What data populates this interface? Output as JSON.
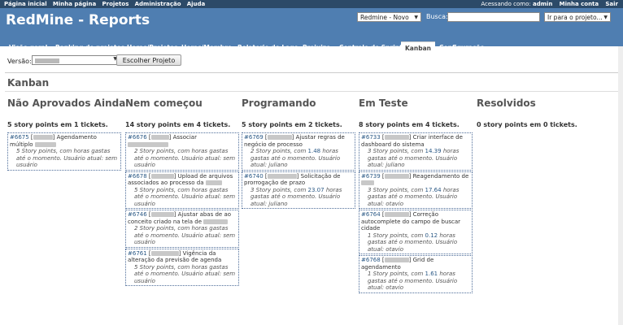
{
  "top_menu": {
    "left": [
      "Página inicial",
      "Minha página",
      "Projetos",
      "Administração",
      "Ajuda"
    ],
    "logged_as_prefix": "Acessando como:",
    "logged_as_user": "admin",
    "my_account": "Minha conta",
    "logout": "Sair"
  },
  "header": {
    "title": "RedMine - Reports",
    "project_select": "Redmine - Novo",
    "search_label": "Busca:",
    "search_value": "",
    "jump_select": "Ir para o projeto..."
  },
  "tabs": [
    {
      "label": "Visão geral"
    },
    {
      "label": "Ranking de projetos"
    },
    {
      "label": "Horas/Projetos"
    },
    {
      "label": "Horas/Membro"
    },
    {
      "label": "Relatorio do Lage"
    },
    {
      "label": "Prejuizo"
    },
    {
      "label": "Controle de Sprint"
    },
    {
      "label": "Kanban",
      "active": true
    },
    {
      "label": "Configuração"
    }
  ],
  "version": {
    "label": "Versão:",
    "button": "Escolher Projeto"
  },
  "page_title": "Kanban",
  "columns": [
    {
      "title": "Não Aprovados Ainda",
      "summary": "5 story points em 1 tickets.",
      "cards": [
        {
          "id": "#6675",
          "title": "Agendamento múltiplo",
          "meta_pre": "5 Story points, com horas gastas até o momento. Usuário atual: sem usuário",
          "hours": ""
        }
      ]
    },
    {
      "title": "Nem começou",
      "summary": "14 story points em 4 tickets.",
      "cards": [
        {
          "id": "#6676",
          "title": "Associar",
          "meta_pre": "2 Story points, com horas gastas até o momento. Usuário atual: sem usuário",
          "hours": ""
        },
        {
          "id": "#6678",
          "title": "Upload de arquivos associados ao processo da",
          "meta_pre": "5 Story points, com horas gastas até o momento. Usuário atual: sem usuário",
          "hours": ""
        },
        {
          "id": "#6746",
          "title": "Ajustar abas de ao conceito criado na tela de",
          "meta_pre": "2 Story points, com horas gastas até o momento. Usuário atual: sem usuário",
          "hours": ""
        },
        {
          "id": "#6761",
          "title": "Vigência da alteração da previsão de agenda",
          "meta_pre": "5 Story points, com horas gastas até o momento. Usuário atual: sem usuário",
          "hours": ""
        }
      ]
    },
    {
      "title": "Programando",
      "summary": "5 story points em 2 tickets.",
      "cards": [
        {
          "id": "#6769",
          "title": "Ajustar regras de negócio de processo",
          "meta_pre": "2 Story points, com",
          "hours": "1.48",
          "meta_post": "horas gastas até o momento. Usuário atual: juliano"
        },
        {
          "id": "#6740",
          "title": "Solicitação de prorrogação de prazo",
          "meta_pre": "3 Story points, com",
          "hours": "23.07",
          "meta_post": "horas gastas até o momento. Usuário atual: juliano"
        }
      ]
    },
    {
      "title": "Em Teste",
      "summary": "8 story points em 4 tickets.",
      "cards": [
        {
          "id": "#6733",
          "title": "Criar interface de dashboard do sistema",
          "meta_pre": "3 Story points, com",
          "hours": "14.39",
          "meta_post": "horas gastas até o momento. Usuário atual: juliano"
        },
        {
          "id": "#6739",
          "title": "Reagendamento de",
          "meta_pre": "3 Story points, com",
          "hours": "17.64",
          "meta_post": "horas gastas até o momento. Usuário atual: otavio"
        },
        {
          "id": "#6764",
          "title": "Correção autocomplete do campo de buscar cidade",
          "meta_pre": "1 Story points, com",
          "hours": "0.12",
          "meta_post": "horas gastas até o momento. Usuário atual: otavio"
        },
        {
          "id": "#6768",
          "title": "Grid de agendamento",
          "meta_pre": "1 Story points, com",
          "hours": "1.61",
          "meta_post": "horas gastas até o momento. Usuário atual: otavio"
        }
      ]
    },
    {
      "title": "Resolvidos",
      "summary": "0 story points em 0 tickets.",
      "cards": []
    }
  ]
}
